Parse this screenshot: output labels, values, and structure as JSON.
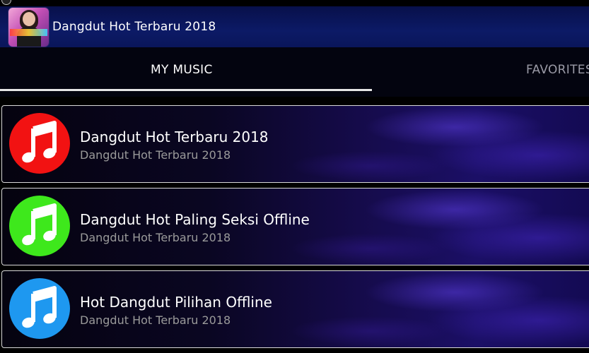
{
  "appbar": {
    "title": "Dangdut Hot Terbaru 2018",
    "icon": "app-logo-icon"
  },
  "tabs": [
    {
      "label": "MY MUSIC",
      "selected": true
    },
    {
      "label": "FAVORITES",
      "selected": false
    }
  ],
  "items": [
    {
      "title": "Dangdut Hot Terbaru 2018",
      "subtitle": "Dangdut Hot Terbaru 2018",
      "icon": "music-note-icon",
      "color": "#f21212"
    },
    {
      "title": "Dangdut Hot Paling Seksi Offline",
      "subtitle": "Dangdut Hot Terbaru 2018",
      "icon": "music-note-icon",
      "color": "#3ee81c"
    },
    {
      "title": "Hot Dangdut Pilihan Offline",
      "subtitle": "Dangdut Hot Terbaru 2018",
      "icon": "music-note-icon",
      "color": "#1e98f0"
    }
  ],
  "colors": {
    "appbar": "#0c1a66",
    "tab_selected": "#ffffff",
    "tab_unselected": "#9a9aa6",
    "subtitle": "#9a9a9a"
  }
}
